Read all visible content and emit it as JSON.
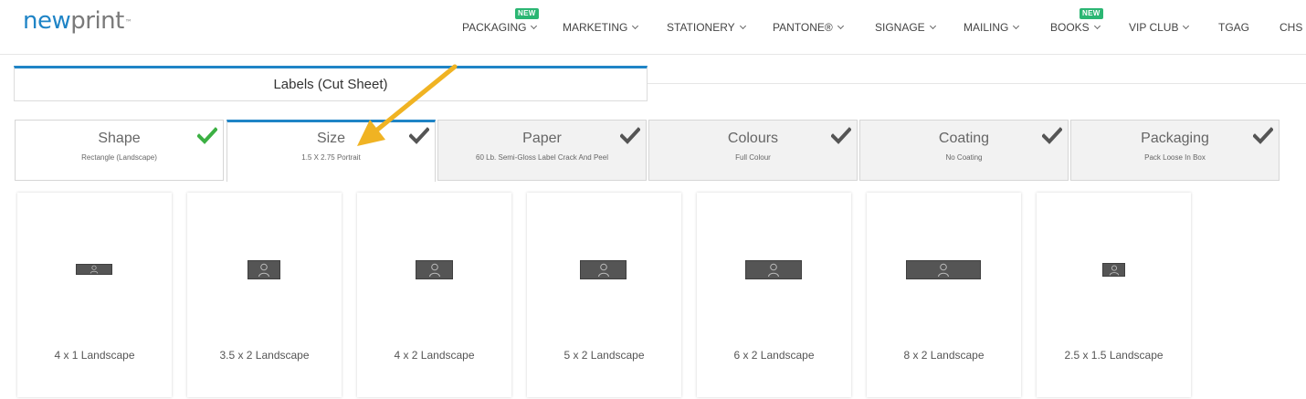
{
  "logo": {
    "part1": "new",
    "part2": "print",
    "tm": "™"
  },
  "nav": [
    {
      "label": "PACKAGING",
      "badge": "NEW"
    },
    {
      "label": "MARKETING"
    },
    {
      "label": "STATIONERY"
    },
    {
      "label": "PANTONE®"
    },
    {
      "label": "SIGNAGE"
    },
    {
      "label": "MAILING"
    },
    {
      "label": "BOOKS",
      "badge": "NEW"
    },
    {
      "label": "VIP CLUB"
    },
    {
      "label": "TGAG"
    },
    {
      "label": "CHS"
    }
  ],
  "product_title": "Labels (Cut Sheet)",
  "steps": [
    {
      "name": "Shape",
      "value": "Rectangle (Landscape)",
      "check_icon": "green-check-icon"
    },
    {
      "name": "Size",
      "value": "1.5 X 2.75 Portrait",
      "check_icon": "gray-check-icon"
    },
    {
      "name": "Paper",
      "value": "60 Lb. Semi-Gloss Label Crack And Peel",
      "check_icon": "gray-check-icon"
    },
    {
      "name": "Colours",
      "value": "Full Colour",
      "check_icon": "gray-check-icon"
    },
    {
      "name": "Coating",
      "value": "No Coating",
      "check_icon": "gray-check-icon"
    },
    {
      "name": "Packaging",
      "value": "Pack Loose In Box",
      "check_icon": "gray-check-icon"
    }
  ],
  "size_options": [
    {
      "label": "4 x 1 Landscape"
    },
    {
      "label": "3.5 x 2 Landscape"
    },
    {
      "label": "4 x 2 Landscape"
    },
    {
      "label": "5 x 2 Landscape"
    },
    {
      "label": "6 x 2 Landscape"
    },
    {
      "label": "8 x 2 Landscape"
    },
    {
      "label": "2.5 x 1.5 Landscape"
    }
  ],
  "colors": {
    "brand_blue": "#1f84c6",
    "check_green": "#3cb043",
    "check_gray": "#555555",
    "badge_green": "#2bb673",
    "annotation_arrow": "#f0b323"
  }
}
